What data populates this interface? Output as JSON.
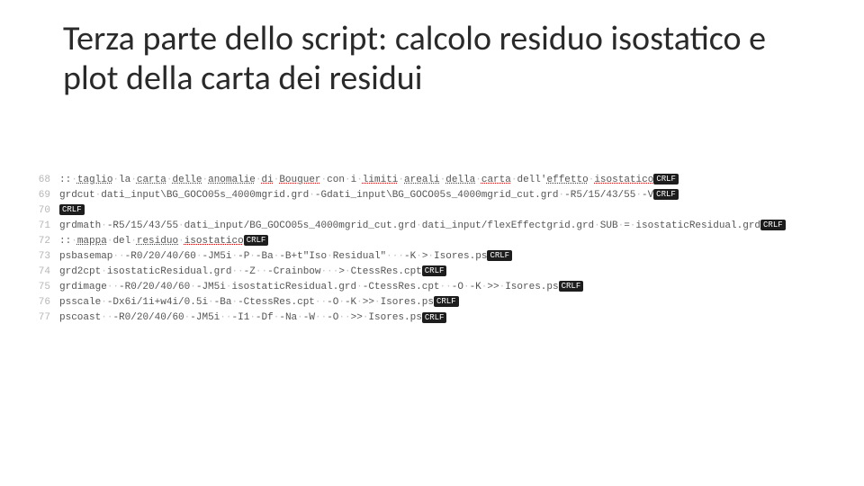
{
  "title": "Terza parte dello script: calcolo residuo isostatico e plot della carta dei residui",
  "lines": [
    {
      "n": "68",
      "html": "::·<span class='squig'>taglio</span>·la·<span class='squig'>carta</span>·<span class='squig'>delle</span>·<span class='squig'>anomalie</span>·<span class='squig'>di</span>·<span class='squig'>Bouguer</span>·con·i·<span class='squig'>limiti</span>·<span class='squig'>areali</span>·<span class='squig'>della</span>·<span class='squig'>carta</span>·dell'<span class='squig'>effetto</span>·<span class='squig'>isostatico</span><span class='crlf'>CRLF</span>"
    },
    {
      "n": "69",
      "html": "grdcut·dati_input\\BG_GOCO05s_4000mgrid.grd·-Gdati_input\\BG_GOCO05s_4000mgrid_cut.grd·-R5/15/43/55·-V<span class='crlf'>CRLF</span>"
    },
    {
      "n": "70",
      "html": "<span class='crlf'>CRLF</span>"
    },
    {
      "n": "71",
      "html": "grdmath·-R5/15/43/55·dati_input/BG_GOCO05s_4000mgrid_cut.grd·dati_input/flexEffectgrid.grd·SUB·=·isostaticResidual.grd<span class='crlf'>CRLF</span>"
    },
    {
      "n": "72",
      "html": "::·<span class='squig'>mappa</span>·del·<span class='squig'>residuo</span>·<span class='squig'>isostatico</span><span class='crlf'>CRLF</span>"
    },
    {
      "n": "73",
      "html": "psbasemap··-R0/20/40/60·-JM5i·-P·-Ba·-B+t\"Iso·Residual\"···-K·&gt;·Isores.ps<span class='crlf'>CRLF</span>"
    },
    {
      "n": "74",
      "html": "grd2cpt·isostaticResidual.grd··-Z··-Crainbow···&gt;·CtessRes.cpt<span class='crlf'>CRLF</span>"
    },
    {
      "n": "75",
      "html": "grdimage··-R0/20/40/60·-JM5i·isostaticResidual.grd·-CtessRes.cpt··-O·-K·&gt;&gt;·Isores.ps<span class='crlf'>CRLF</span>"
    },
    {
      "n": "76",
      "html": "psscale·-Dx6i/1i+w4i/0.5i·-Ba·-CtessRes.cpt··-O·-K·&gt;&gt;·Isores.ps<span class='crlf'>CRLF</span>"
    },
    {
      "n": "77",
      "html": "pscoast··-R0/20/40/60·-JM5i··-I1·-Df·-Na·-W··-O··&gt;&gt;·Isores.ps<span class='crlf'>CRLF</span>"
    }
  ]
}
